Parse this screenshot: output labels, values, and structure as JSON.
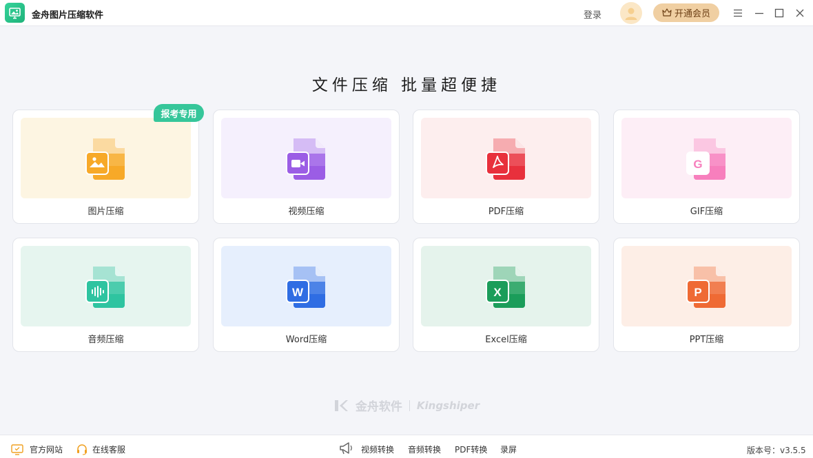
{
  "app": {
    "title": "金舟图片压缩软件"
  },
  "header": {
    "login_label": "登录",
    "vip_label": "开通会员"
  },
  "headline": "文件压缩  批量超便捷",
  "badge": "报考专用",
  "cards": [
    {
      "label": "图片压缩",
      "icon": "image-file-icon",
      "bg": "#fdf5e2",
      "color": "#f7a928",
      "glyph": "img"
    },
    {
      "label": "视频压缩",
      "icon": "video-file-icon",
      "bg": "#f5f0fd",
      "color": "#9b5de5",
      "glyph": "video"
    },
    {
      "label": "PDF压缩",
      "icon": "pdf-file-icon",
      "bg": "#fdeeee",
      "color": "#e8303c",
      "glyph": "pdf"
    },
    {
      "label": "GIF压缩",
      "icon": "gif-file-icon",
      "bg": "#fdeef6",
      "color": "#f77fbd",
      "glyph": "G"
    },
    {
      "label": "音频压缩",
      "icon": "audio-file-icon",
      "bg": "#e6f5ef",
      "color": "#2ec4a0",
      "glyph": "audio"
    },
    {
      "label": "Word压缩",
      "icon": "word-file-icon",
      "bg": "#e6effd",
      "color": "#2f6de3",
      "glyph": "W"
    },
    {
      "label": "Excel压缩",
      "icon": "excel-file-icon",
      "bg": "#e5f3ec",
      "color": "#1b9d5a",
      "glyph": "X"
    },
    {
      "label": "PPT压缩",
      "icon": "ppt-file-icon",
      "bg": "#fdeee6",
      "color": "#ef6a34",
      "glyph": "P"
    }
  ],
  "watermark": {
    "cn": "金舟软件",
    "en": "Kingshiper"
  },
  "footer": {
    "website": "官方网站",
    "service": "在线客服",
    "video_convert": "视频转换",
    "audio_convert": "音频转换",
    "pdf_convert": "PDF转换",
    "record": "录屏",
    "version": "版本号：v3.5.5"
  }
}
